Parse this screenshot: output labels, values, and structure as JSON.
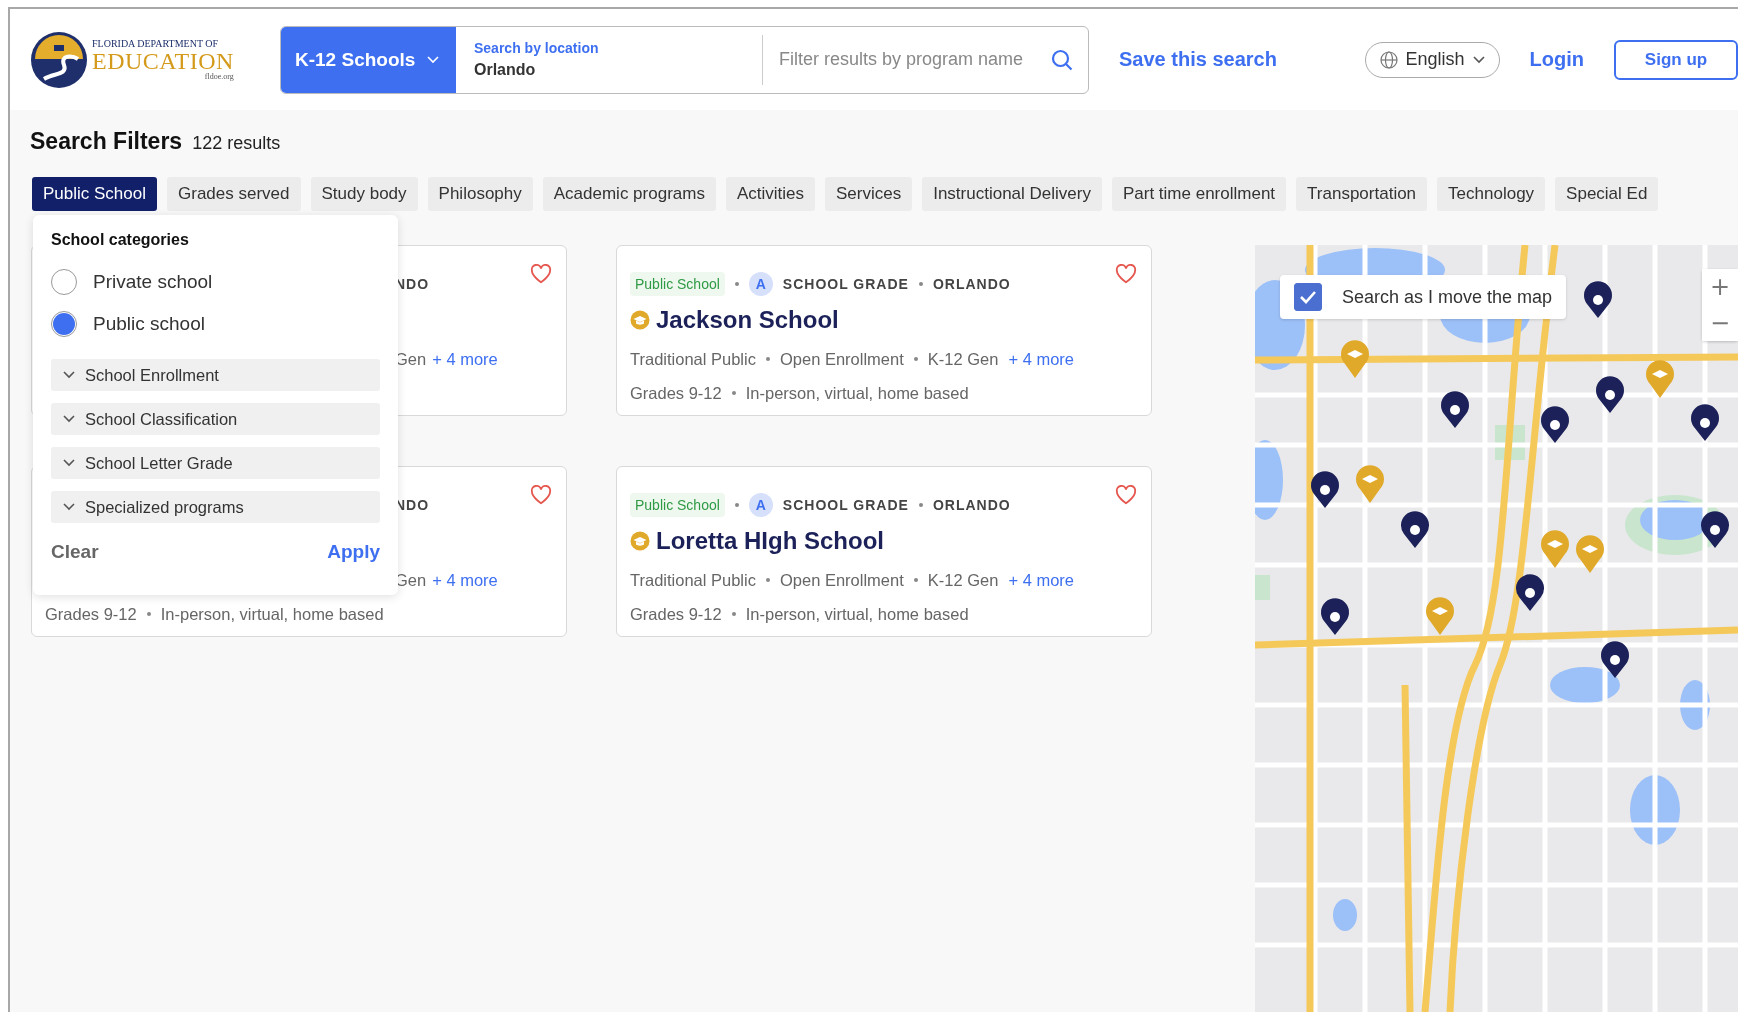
{
  "header": {
    "logo": {
      "line_1": "FLORIDA DEPARTMENT OF",
      "line_2": "EDUCATION",
      "url": "fldoe.org"
    },
    "search": {
      "category": "K-12 Schools",
      "location_label": "Search by location",
      "location_value": "Orlando",
      "filter_placeholder": "Filter results by program name"
    },
    "save_search": "Save this search",
    "language": "English",
    "login": "Login",
    "signup": "Sign up"
  },
  "filters": {
    "title": "Search Filters",
    "count": "122 results",
    "chips": [
      {
        "label": "Public School",
        "selected": true
      },
      {
        "label": "Grades served",
        "selected": false
      },
      {
        "label": "Study body",
        "selected": false
      },
      {
        "label": "Philosophy",
        "selected": false
      },
      {
        "label": "Academic programs",
        "selected": false
      },
      {
        "label": "Activities",
        "selected": false
      },
      {
        "label": "Services",
        "selected": false
      },
      {
        "label": "Instructional Delivery",
        "selected": false
      },
      {
        "label": "Part time enrollment",
        "selected": false
      },
      {
        "label": "Transportation",
        "selected": false
      },
      {
        "label": "Technology",
        "selected": false
      },
      {
        "label": "Special Ed",
        "selected": false
      }
    ]
  },
  "dropdown": {
    "title": "School categories",
    "options": [
      {
        "label": "Private school",
        "selected": false
      },
      {
        "label": "Public school",
        "selected": true
      }
    ],
    "sections": [
      "School Enrollment",
      "School Classification",
      "School Letter Grade",
      "Specialized programs"
    ],
    "clear": "Clear",
    "apply": "Apply"
  },
  "results": [
    {
      "kind": "partial",
      "location": "NDO",
      "features": "Gen",
      "more": "+ 4 more"
    },
    {
      "kind": "full",
      "type": "Public School",
      "grade": "A",
      "grade_label": "SCHOOL GRADE",
      "location": "ORLANDO",
      "name": "Jackson School",
      "features": [
        "Traditional Public",
        "Open Enrollment",
        "K-12 Gen"
      ],
      "more": "+ 4 more",
      "grades": "Grades 9-12",
      "delivery": "In-person, virtual, home based"
    },
    {
      "kind": "partial",
      "location": "NDO",
      "features": "Gen",
      "more": "+ 4 more",
      "grades": "Grades 9-12",
      "delivery": "In-person, virtual, home based"
    },
    {
      "kind": "full",
      "type": "Public School",
      "grade": "A",
      "grade_label": "SCHOOL GRADE",
      "location": "ORLANDO",
      "name": "Loretta HIgh School",
      "features": [
        "Traditional Public",
        "Open Enrollment",
        "K-12 Gen"
      ],
      "more": "+ 4 more",
      "grades": "Grades 9-12",
      "delivery": "In-person, virtual, home based"
    }
  ],
  "map": {
    "search_as_move": {
      "label": "Search as I move the map",
      "checked": true
    },
    "zoom_in": "+",
    "zoom_out": "−"
  }
}
